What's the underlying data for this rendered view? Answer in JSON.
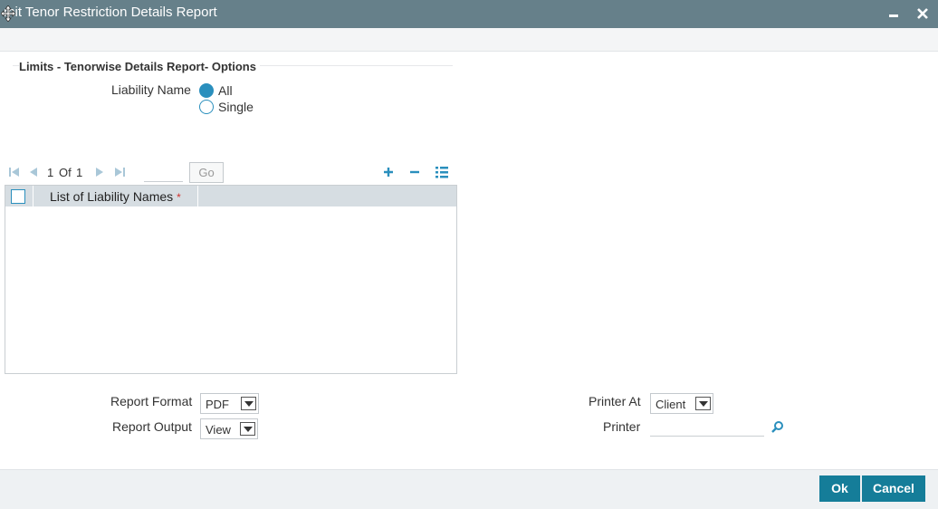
{
  "window": {
    "title": "mit Tenor Restriction Details Report"
  },
  "form": {
    "section_title": "Limits - Tenorwise Details Report- Options",
    "liability_name_label": "Liability Name",
    "liability_options": [
      {
        "label": "All",
        "checked": true
      },
      {
        "label": "Single",
        "checked": false
      }
    ]
  },
  "pager": {
    "current": "1",
    "of_label": "Of",
    "total": "1",
    "go_label": "Go"
  },
  "grid": {
    "column_header": "List of Liability Names",
    "required_mark": "*"
  },
  "report": {
    "format_label": "Report Format",
    "format_value": "PDF",
    "output_label": "Report Output",
    "output_value": "View",
    "printer_at_label": "Printer At",
    "printer_at_value": "Client",
    "printer_label": "Printer"
  },
  "footer": {
    "ok_label": "Ok",
    "cancel_label": "Cancel"
  },
  "colors": {
    "titlebar": "#66808a",
    "accent": "#2a8fbd",
    "button": "#157d99",
    "grid_header": "#d6dde2",
    "required": "#d0312d"
  }
}
